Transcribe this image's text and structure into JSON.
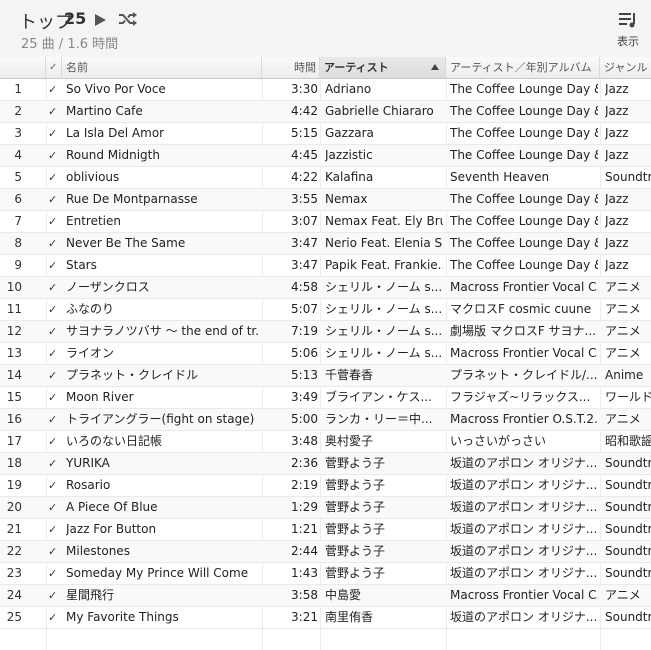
{
  "header": {
    "title": "トップ",
    "count": "25",
    "subtitle": "25 曲 / 1.6 時間",
    "view_label": "表示"
  },
  "icons": [
    "play-icon",
    "shuffle-icon",
    "view-options-icon",
    "checkmark-icon",
    "sort-ascending-icon"
  ],
  "columns": {
    "check": "✓",
    "name": "名前",
    "time": "時間",
    "artist": "アーティスト",
    "album_by_artist": "アーティスト／年別アルバム",
    "genre": "ジャンル"
  },
  "sorted_column": "artist",
  "tracks": [
    {
      "num": "1",
      "checked": "✓",
      "name": "So Vivo Por Voce",
      "time": "3:30",
      "artist": "Adriano",
      "album": "The Coffee Lounge Day &...",
      "genre": "Jazz"
    },
    {
      "num": "2",
      "checked": "✓",
      "name": "Martino Cafe",
      "time": "4:42",
      "artist": "Gabrielle Chiararo",
      "album": "The Coffee Lounge Day &...",
      "genre": "Jazz"
    },
    {
      "num": "3",
      "checked": "✓",
      "name": "La Isla Del Amor",
      "time": "5:15",
      "artist": "Gazzara",
      "album": "The Coffee Lounge Day &...",
      "genre": "Jazz"
    },
    {
      "num": "4",
      "checked": "✓",
      "name": "Round Midnigth",
      "time": "4:45",
      "artist": "Jazzistic",
      "album": "The Coffee Lounge Day &...",
      "genre": "Jazz"
    },
    {
      "num": "5",
      "checked": "✓",
      "name": "oblivious",
      "time": "4:22",
      "artist": "Kalafina",
      "album": "Seventh Heaven",
      "genre": "Soundtra"
    },
    {
      "num": "6",
      "checked": "✓",
      "name": "Rue De Montparnasse",
      "time": "3:55",
      "artist": "Nemax",
      "album": "The Coffee Lounge Day &...",
      "genre": "Jazz"
    },
    {
      "num": "7",
      "checked": "✓",
      "name": "Entretien",
      "time": "3:07",
      "artist": "Nemax Feat. Ely Bru...",
      "album": "The Coffee Lounge Day &...",
      "genre": "Jazz"
    },
    {
      "num": "8",
      "checked": "✓",
      "name": "Never Be The Same",
      "time": "3:47",
      "artist": "Nerio Feat. Elenia S...",
      "album": "The Coffee Lounge Day &...",
      "genre": "Jazz"
    },
    {
      "num": "9",
      "checked": "✓",
      "name": "Stars",
      "time": "3:47",
      "artist": "Papik Feat. Frankie...",
      "album": "The Coffee Lounge Day &...",
      "genre": "Jazz"
    },
    {
      "num": "10",
      "checked": "✓",
      "name": "ノーザンクロス",
      "time": "4:58",
      "artist": "シェリル・ノーム s...",
      "album": "Macross Frontier Vocal C...",
      "genre": "アニメ"
    },
    {
      "num": "11",
      "checked": "✓",
      "name": "ふなのり",
      "time": "5:07",
      "artist": "シェリル・ノーム s...",
      "album": "マクロスF cosmic cuune",
      "genre": "アニメ"
    },
    {
      "num": "12",
      "checked": "✓",
      "name": "サヨナラノツバサ ～ the end of tr...",
      "time": "7:19",
      "artist": "シェリル・ノーム s...",
      "album": "劇場版 マクロスF サヨナ...",
      "genre": "アニメ"
    },
    {
      "num": "13",
      "checked": "✓",
      "name": "ライオン",
      "time": "5:06",
      "artist": "シェリル・ノーム s...",
      "album": "Macross Frontier Vocal C...",
      "genre": "アニメ"
    },
    {
      "num": "14",
      "checked": "✓",
      "name": "プラネット・クレイドル",
      "time": "5:13",
      "artist": "千菅春香",
      "album": "プラネット・クレイドル/...",
      "genre": "Anime"
    },
    {
      "num": "15",
      "checked": "✓",
      "name": "Moon River",
      "time": "3:49",
      "artist": "ブライアン・ケス...",
      "album": "フラジャズ~リラックス...",
      "genre": "ワールド"
    },
    {
      "num": "16",
      "checked": "✓",
      "name": "トライアングラー(fight on stage)",
      "time": "5:00",
      "artist": "ランカ・リー＝中...",
      "album": "Macross Frontier O.S.T.2...",
      "genre": "アニメ"
    },
    {
      "num": "17",
      "checked": "✓",
      "name": "いろのない日記帳",
      "time": "3:48",
      "artist": "奥村愛子",
      "album": "いっさいがっさい",
      "genre": "昭和歌謡"
    },
    {
      "num": "18",
      "checked": "✓",
      "name": "YURIKA",
      "time": "2:36",
      "artist": "菅野よう子",
      "album": "坂道のアポロン オリジナ...",
      "genre": "Soundtra"
    },
    {
      "num": "19",
      "checked": "✓",
      "name": "Rosario",
      "time": "2:19",
      "artist": "菅野よう子",
      "album": "坂道のアポロン オリジナ...",
      "genre": "Soundtra"
    },
    {
      "num": "20",
      "checked": "✓",
      "name": "A Piece Of Blue",
      "time": "1:29",
      "artist": "菅野よう子",
      "album": "坂道のアポロン オリジナ...",
      "genre": "Soundtra"
    },
    {
      "num": "21",
      "checked": "✓",
      "name": "Jazz For Button",
      "time": "1:21",
      "artist": "菅野よう子",
      "album": "坂道のアポロン オリジナ...",
      "genre": "Soundtra"
    },
    {
      "num": "22",
      "checked": "✓",
      "name": "Milestones",
      "time": "2:44",
      "artist": "菅野よう子",
      "album": "坂道のアポロン オリジナ...",
      "genre": "Soundtra"
    },
    {
      "num": "23",
      "checked": "✓",
      "name": "Someday My Prince Will Come",
      "time": "1:43",
      "artist": "菅野よう子",
      "album": "坂道のアポロン オリジナ...",
      "genre": "Soundtra"
    },
    {
      "num": "24",
      "checked": "✓",
      "name": "星間飛行",
      "time": "3:58",
      "artist": "中島愛",
      "album": "Macross Frontier Vocal C...",
      "genre": "アニメ"
    },
    {
      "num": "25",
      "checked": "✓",
      "name": "My Favorite Things",
      "time": "3:21",
      "artist": "南里侑香",
      "album": "坂道のアポロン オリジナ...",
      "genre": "Soundtra"
    }
  ]
}
